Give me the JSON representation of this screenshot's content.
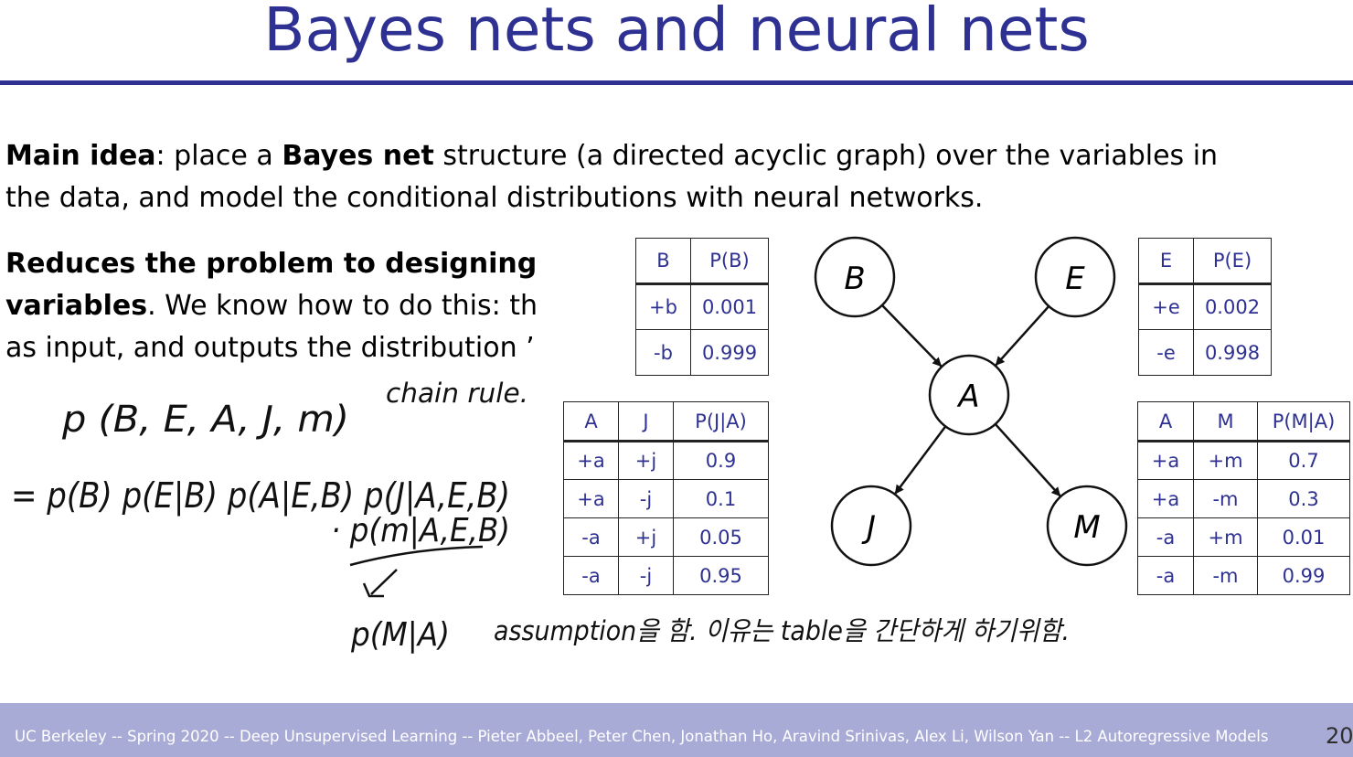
{
  "slide": {
    "title": "Bayes nets and neural nets",
    "para1": {
      "line1": [
        {
          "text": "Main idea",
          "bold": true
        },
        {
          "text": ": place a ",
          "bold": false
        },
        {
          "text": "Bayes net",
          "bold": true
        },
        {
          "text": " structure (a directed acyclic graph) over the variables in",
          "bold": false
        }
      ],
      "line2": "the data, and model the conditional distributions with neural networks."
    },
    "para2": {
      "line1": "Reduces the problem to designing cor",
      "line2_bold": "variables",
      "line2_rest": ". We know how to do this: th",
      "line3": "as input, and outputs the distribution ’"
    },
    "footer": "UC Berkeley -- Spring 2020 -- Deep Unsupervised Learning -- Pieter Abbeel, Peter Chen, Jonathan Ho, Aravind Srinivas, Alex Li, Wilson Yan -- L2 Autoregressive Models",
    "page_number": "20"
  },
  "graph": {
    "nodes": {
      "B": "B",
      "E": "E",
      "A": "A",
      "J": "J",
      "M": "M"
    },
    "edges": [
      [
        "B",
        "A"
      ],
      [
        "E",
        "A"
      ],
      [
        "A",
        "J"
      ],
      [
        "A",
        "M"
      ]
    ]
  },
  "tables": {
    "pb": {
      "headers": [
        "B",
        "P(B)"
      ],
      "rows": [
        [
          "+b",
          "0.001"
        ],
        [
          "-b",
          "0.999"
        ]
      ]
    },
    "pe": {
      "headers": [
        "E",
        "P(E)"
      ],
      "rows": [
        [
          "+e",
          "0.002"
        ],
        [
          "-e",
          "0.998"
        ]
      ]
    },
    "pj": {
      "headers": [
        "A",
        "J",
        "P(J|A)"
      ],
      "rows": [
        [
          "+a",
          "+j",
          "0.9"
        ],
        [
          "+a",
          "-j",
          "0.1"
        ],
        [
          "-a",
          "+j",
          "0.05"
        ],
        [
          "-a",
          "-j",
          "0.95"
        ]
      ]
    },
    "pm": {
      "headers": [
        "A",
        "M",
        "P(M|A)"
      ],
      "rows": [
        [
          "+a",
          "+m",
          "0.7"
        ],
        [
          "+a",
          "-m",
          "0.3"
        ],
        [
          "-a",
          "+m",
          "0.01"
        ],
        [
          "-a",
          "-m",
          "0.99"
        ]
      ]
    }
  },
  "annotations": {
    "joint": "p (B, E, A, J, m)",
    "chain_rule": "chain rule.",
    "expansion1": "= p(B) p(E|B) p(A|E,B) p(J|A,E,B)",
    "expansion2": "· p(m|A,E,B)",
    "simplified": "p(M|A)",
    "note": "assumption을 함. 이유는 table을 간단하게 하기위함."
  },
  "colors": {
    "title": "#2e3192",
    "footer_band": "#a9abd7",
    "table_text": "#2e3192",
    "ink": "#111111"
  }
}
